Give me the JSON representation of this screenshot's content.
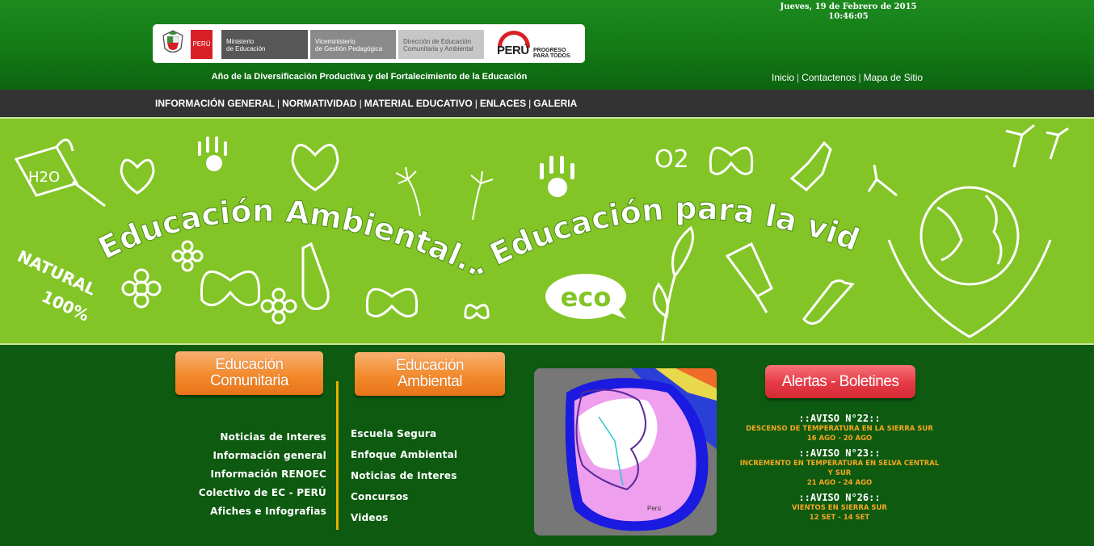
{
  "header": {
    "date": "Jueves, 19 de Febrero de 2015",
    "time": "10:46:05",
    "year_motto": "Año de la Diversificación Productiva y del Fortalecimiento de la Educación",
    "logos": {
      "peru": "PERÚ",
      "ministerio": [
        "Ministerio",
        "de Educación"
      ],
      "viceministerio": [
        "Viceministerio",
        "de Gestión Pedagógica"
      ],
      "direccion": [
        "Dirección de Educación",
        "Comunitaria y Ambiental"
      ],
      "brand_word": "PERÚ",
      "brand_tagline": [
        "PROGRESO",
        "PARA TODOS"
      ]
    },
    "top_links": [
      "Inicio",
      "Contactenos",
      "Mapa de Sitio"
    ]
  },
  "nav": [
    "INFORMACIÓN GENERAL",
    "NORMATIVIDAD",
    "MATERIAL EDUCATIVO",
    "ENLACES",
    "GALERIA"
  ],
  "banner": {
    "title": "Educación Ambiental... Educación para la vida",
    "h2o": "H2O",
    "o2": "O2",
    "natural": [
      "NATURAL",
      "100%"
    ],
    "eco": "eco"
  },
  "sections": {
    "comunitaria_button": [
      "Educación",
      "Comunitaria"
    ],
    "ambiental_button": [
      "Educación",
      "Ambiental"
    ],
    "alertas_button": "Alertas - Boletines",
    "comunitaria_links": [
      "Noticias de Interes",
      "Información general",
      "Información RENOEC",
      "Colectivo de EC - PERÚ",
      "Afiches e Infografias"
    ],
    "ambiental_links": [
      "Escuela Segura",
      "Enfoque Ambiental",
      "Noticias de Interes",
      "Concursos",
      "Videos"
    ],
    "map_label": "Perú"
  },
  "alerts": [
    {
      "title": "::AVISO N°22::",
      "lines": [
        "DESCENSO DE TEMPERATURA EN LA SIERRA SUR",
        "16 AGO - 20 AGO"
      ]
    },
    {
      "title": "::AVISO N°23::",
      "lines": [
        "INCREMENTO EN TEMPERATURA EN SELVA CENTRAL",
        "Y SUR",
        "21 AGO - 24 AGO"
      ]
    },
    {
      "title": "::AVISO N°26::",
      "lines": [
        "VIENTOS EN SIERRA SUR",
        "12 SET - 14 SET"
      ]
    }
  ],
  "colors": {
    "header_green": "#137a16",
    "page_green": "#0d5a10",
    "nav_gray": "#333333",
    "banner_green": "#83c427",
    "orange_button": "#f28a2c",
    "red_button": "#e53a45",
    "alert_orange": "#f6a623",
    "divider_gold": "#e3b100"
  }
}
